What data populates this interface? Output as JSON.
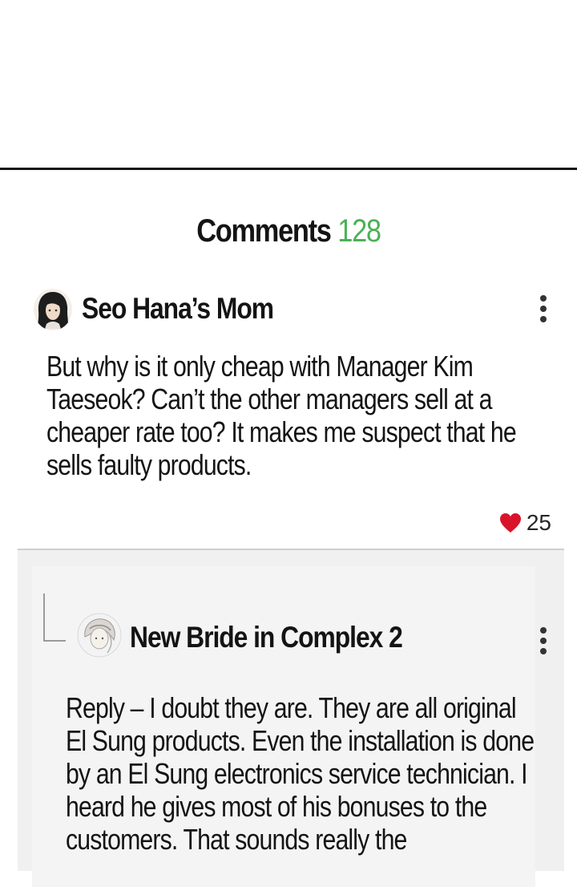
{
  "comments_header": {
    "title": "Comments",
    "count": "128"
  },
  "comment": {
    "author": "Seo Hana’s Mom",
    "avatar_icon": "woman-avatar-icon",
    "body": "But why is it only cheap with Manager Kim Taeseok? Can’t the other managers sell at a cheaper rate too? It makes me suspect that he sells faulty products.",
    "likes": "25",
    "like_icon": "heart-icon",
    "more_icon": "vertical-dots-icon"
  },
  "reply": {
    "author": "New Bride in Complex 2",
    "avatar_icon": "bride-avatar-icon",
    "body": "Reply – I doubt they are. They are all original El Sung products. Even the installation is done by an El Sung electronics service technician. I heard he gives most of his bonuses to the customers. That sounds really the",
    "more_icon": "vertical-dots-icon"
  },
  "colors": {
    "count_green": "#4bb056",
    "heart_red": "#d9142a",
    "reply_bg": "#f0f0f0"
  }
}
